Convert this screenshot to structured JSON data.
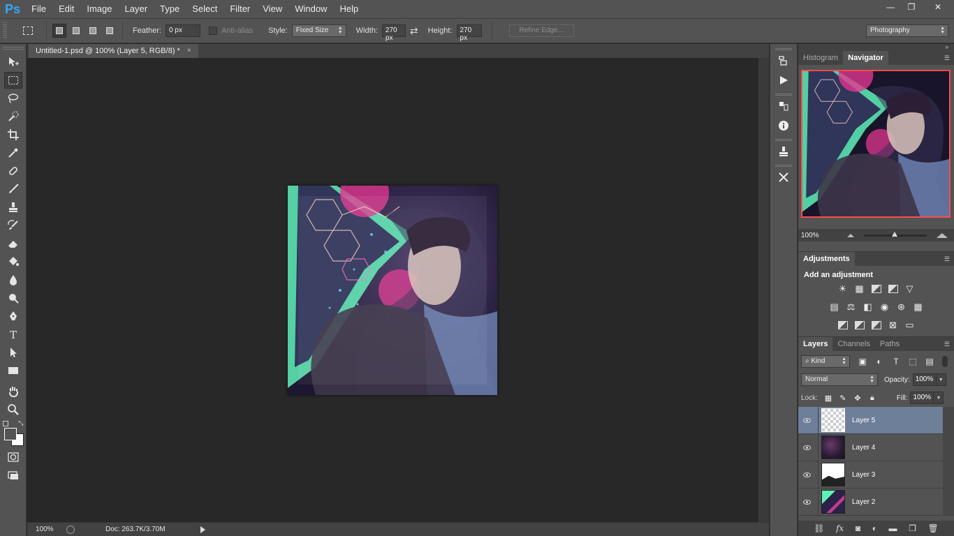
{
  "app": {
    "logo": "Ps"
  },
  "menu": [
    "File",
    "Edit",
    "Image",
    "Layer",
    "Type",
    "Select",
    "Filter",
    "View",
    "Window",
    "Help"
  ],
  "window_controls": {
    "minimize": "—",
    "restore": "❐",
    "close": "✕"
  },
  "options": {
    "feather_label": "Feather:",
    "feather_value": "0 px",
    "antialias_label": "Anti-alias",
    "style_label": "Style:",
    "style_value": "Fixed Size",
    "width_label": "Width:",
    "width_value": "270 px",
    "height_label": "Height:",
    "height_value": "270 px",
    "refine_edge": "Refine Edge...",
    "workspace": "Photography"
  },
  "document": {
    "tab_title": "Untitled-1.psd @ 100% (Layer 5, RGB/8) *",
    "tab_close": "×"
  },
  "status": {
    "zoom": "100%",
    "doc_info": "Doc: 263.7K/3.70M"
  },
  "panels": {
    "top_tabs": [
      "Histogram",
      "Navigator"
    ],
    "active_top_tab": "Navigator",
    "navigator_zoom": "100%",
    "adjustments_tab": "Adjustments",
    "adjustments_title": "Add an adjustment",
    "layers_tabs": [
      "Layers",
      "Channels",
      "Paths"
    ],
    "kind_label": "Kind",
    "blend_mode": "Normal",
    "opacity_label": "Opacity:",
    "opacity_value": "100%",
    "lock_label": "Lock:",
    "fill_label": "Fill:",
    "fill_value": "100%"
  },
  "layers": [
    {
      "name": "Layer 5",
      "selected": true,
      "thumb": "checker"
    },
    {
      "name": "Layer 4",
      "selected": false,
      "thumb": "dark"
    },
    {
      "name": "Layer 3",
      "selected": false,
      "thumb": "mask"
    },
    {
      "name": "Layer 2",
      "selected": false,
      "thumb": "photo"
    }
  ],
  "colors": {
    "brand": "#31a8ff",
    "chrome": "#535353",
    "canvas_bg": "#282828",
    "selection": "#6e7f9a",
    "navigator_frame": "#ff4b4b"
  },
  "icons": {
    "tools": [
      "move-icon",
      "rect-marquee-icon",
      "lasso-icon",
      "quick-select-icon",
      "crop-icon",
      "eyedropper-icon",
      "healing-brush-icon",
      "brush-icon",
      "clone-stamp-icon",
      "history-brush-icon",
      "eraser-icon",
      "paint-bucket-icon",
      "blur-icon",
      "dodge-icon",
      "pen-icon",
      "type-icon",
      "path-select-icon",
      "rectangle-icon",
      "hand-icon",
      "zoom-icon"
    ]
  }
}
